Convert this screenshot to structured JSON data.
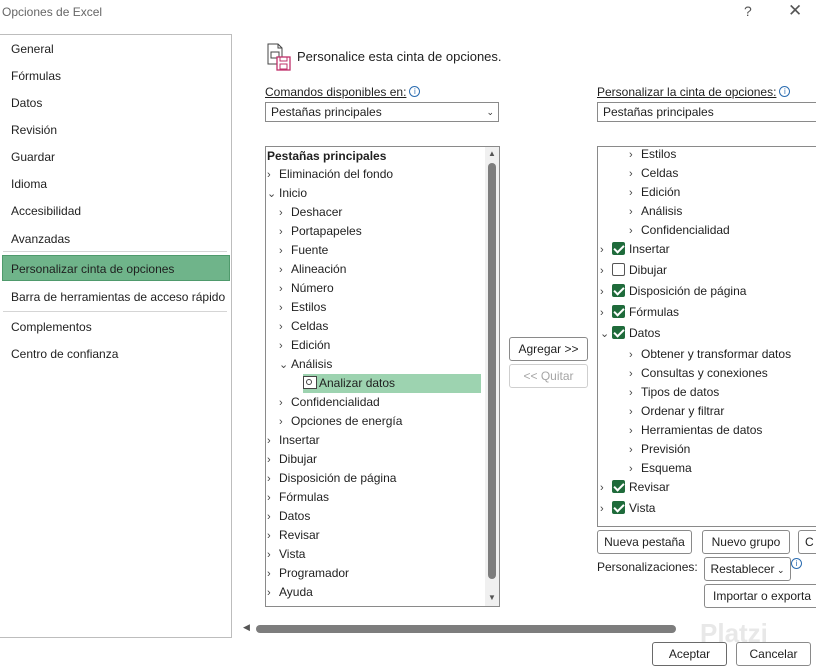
{
  "window": {
    "title": "Opciones de Excel",
    "help": "?",
    "close": "✕"
  },
  "nav": {
    "items": [
      {
        "label": "General"
      },
      {
        "label": "Fórmulas"
      },
      {
        "label": "Datos"
      },
      {
        "label": "Revisión"
      },
      {
        "label": "Guardar"
      },
      {
        "label": "Idioma"
      },
      {
        "label": "Accesibilidad"
      },
      {
        "label": "Avanzadas"
      },
      {
        "label": "Personalizar cinta de opciones"
      },
      {
        "label": "Barra de herramientas de acceso rápido"
      },
      {
        "label": "Complementos"
      },
      {
        "label": "Centro de confianza"
      }
    ]
  },
  "main": {
    "header": "Personalice esta cinta de opciones.",
    "left": {
      "label": "Comandos disponibles en:",
      "selected": "Pestañas principales",
      "rows": [
        {
          "label": "Pestañas principales",
          "chev": ""
        },
        {
          "label": "Eliminación del fondo",
          "chev": "›"
        },
        {
          "label": "Inicio",
          "chev": "⌄"
        },
        {
          "label": "Deshacer",
          "chev": "›"
        },
        {
          "label": "Portapapeles",
          "chev": "›"
        },
        {
          "label": "Fuente",
          "chev": "›"
        },
        {
          "label": "Alineación",
          "chev": "›"
        },
        {
          "label": "Número",
          "chev": "›"
        },
        {
          "label": "Estilos",
          "chev": "›"
        },
        {
          "label": "Celdas",
          "chev": "›"
        },
        {
          "label": "Edición",
          "chev": "›"
        },
        {
          "label": "Análisis",
          "chev": "⌄"
        },
        {
          "label": "Analizar datos",
          "chev": ""
        },
        {
          "label": "Confidencialidad",
          "chev": "›"
        },
        {
          "label": "Opciones de energía",
          "chev": "›"
        },
        {
          "label": "Insertar",
          "chev": "›"
        },
        {
          "label": "Dibujar",
          "chev": "›"
        },
        {
          "label": "Disposición de página",
          "chev": "›"
        },
        {
          "label": "Fórmulas",
          "chev": "›"
        },
        {
          "label": "Datos",
          "chev": "›"
        },
        {
          "label": "Revisar",
          "chev": "›"
        },
        {
          "label": "Vista",
          "chev": "›"
        },
        {
          "label": "Programador",
          "chev": "›"
        },
        {
          "label": "Ayuda",
          "chev": "›"
        }
      ]
    },
    "middle": {
      "add": "Agregar >>",
      "remove": "<< Quitar"
    },
    "right": {
      "label": "Personalizar la cinta de opciones:",
      "selected": "Pestañas principales",
      "rows": [
        {
          "label": "Estilos",
          "chev": "›"
        },
        {
          "label": "Celdas",
          "chev": "›"
        },
        {
          "label": "Edición",
          "chev": "›"
        },
        {
          "label": "Análisis",
          "chev": "›"
        },
        {
          "label": "Confidencialidad",
          "chev": "›"
        },
        {
          "label": "Insertar",
          "chev": "›"
        },
        {
          "label": "Dibujar",
          "chev": "›"
        },
        {
          "label": "Disposición de página",
          "chev": "›"
        },
        {
          "label": "Fórmulas",
          "chev": "›"
        },
        {
          "label": "Datos",
          "chev": "⌄"
        },
        {
          "label": "Obtener y transformar datos",
          "chev": "›"
        },
        {
          "label": "Consultas y conexiones",
          "chev": "›"
        },
        {
          "label": "Tipos de datos",
          "chev": "›"
        },
        {
          "label": "Ordenar y filtrar",
          "chev": "›"
        },
        {
          "label": "Herramientas de datos",
          "chev": "›"
        },
        {
          "label": "Previsión",
          "chev": "›"
        },
        {
          "label": "Esquema",
          "chev": "›"
        },
        {
          "label": "Revisar",
          "chev": "›"
        },
        {
          "label": "Vista",
          "chev": "›"
        }
      ],
      "new_tab": "Nueva pestaña",
      "new_group": "Nuevo grupo",
      "rename": "C",
      "customizations_label": "Personalizaciones:",
      "reset": "Restablecer",
      "import_export": "Importar o exporta"
    }
  },
  "footer": {
    "ok": "Aceptar",
    "cancel": "Cancelar",
    "watermark": "Platzi"
  },
  "colors": {
    "accent": "#6fb48a",
    "selection": "#9dd3b0",
    "check": "#1f6b3b"
  }
}
